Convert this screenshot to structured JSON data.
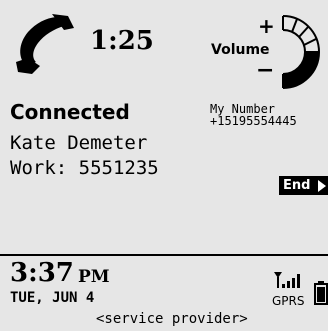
{
  "call": {
    "timer": "1:25",
    "status": "Connected",
    "contact_name": "Kate Demeter",
    "contact_number": "Work: 5551235",
    "end_label": "End"
  },
  "volume": {
    "label": "Volume",
    "plus": "+",
    "minus": "−"
  },
  "my_number": {
    "label": "My Number",
    "value": "+15195554445"
  },
  "status_bar": {
    "time": "3:37",
    "ampm": "PM",
    "date": "TUE, JUN 4",
    "provider": "<service provider>",
    "network": "GPRS"
  },
  "icons": [
    "phone-handset-icon",
    "volume-dial-icon",
    "end-arrow-icon",
    "signal-strength-icon",
    "battery-icon"
  ]
}
